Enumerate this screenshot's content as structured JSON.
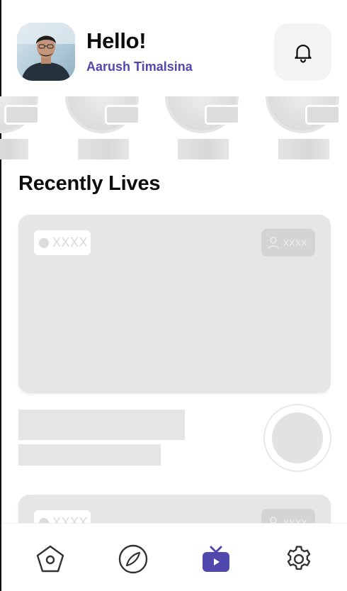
{
  "header": {
    "greeting": "Hello!",
    "user_name": "Aarush Timalsina",
    "avatar_icon": "user-photo",
    "notification_icon": "bell-icon"
  },
  "stories": {
    "count_visible": 4
  },
  "recent_lives": {
    "title": "Recently Lives",
    "cards": [
      {
        "live_label": "XXXX",
        "viewer_label": "xxxx"
      },
      {
        "live_label": "XXXX",
        "viewer_label": "xxxx"
      }
    ]
  },
  "bottom_nav": {
    "items": [
      {
        "icon": "home-icon",
        "active": false
      },
      {
        "icon": "compass-icon",
        "active": false
      },
      {
        "icon": "tv-icon",
        "active": true
      },
      {
        "icon": "settings-icon",
        "active": false
      }
    ]
  },
  "colors": {
    "accent": "#5048ad",
    "skeleton": "#e6e6e6",
    "text": "#0d0d0d"
  }
}
